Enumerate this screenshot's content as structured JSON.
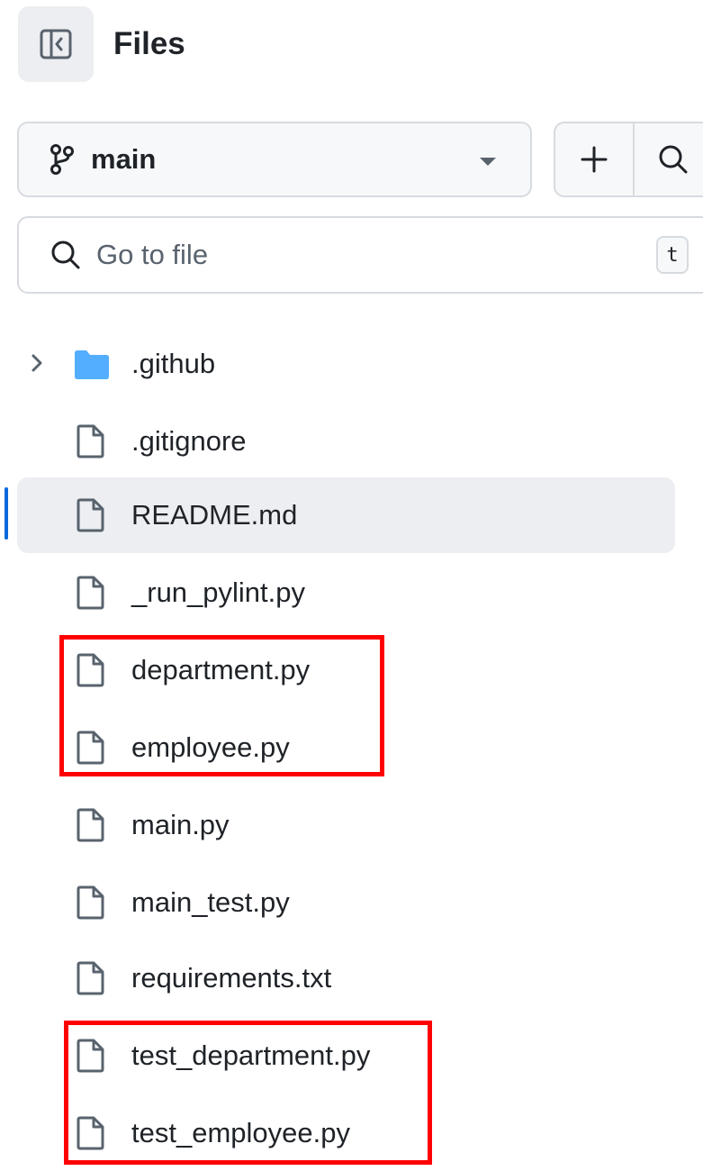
{
  "header": {
    "title": "Files"
  },
  "branch": {
    "name": "main"
  },
  "search": {
    "placeholder": "Go to file",
    "shortcut": "t"
  },
  "tree": [
    {
      "label": ".github",
      "type": "folder"
    },
    {
      "label": ".gitignore",
      "type": "file"
    },
    {
      "label": "README.md",
      "type": "file",
      "selected": true
    },
    {
      "label": "_run_pylint.py",
      "type": "file"
    },
    {
      "label": "department.py",
      "type": "file"
    },
    {
      "label": "employee.py",
      "type": "file"
    },
    {
      "label": "main.py",
      "type": "file"
    },
    {
      "label": "main_test.py",
      "type": "file"
    },
    {
      "label": "requirements.txt",
      "type": "file"
    },
    {
      "label": "test_department.py",
      "type": "file"
    },
    {
      "label": "test_employee.py",
      "type": "file"
    }
  ],
  "colors": {
    "accent": "#0969da",
    "folder": "#54aeff",
    "highlight": "#ff0000",
    "selected_bg": "#eceef1"
  }
}
